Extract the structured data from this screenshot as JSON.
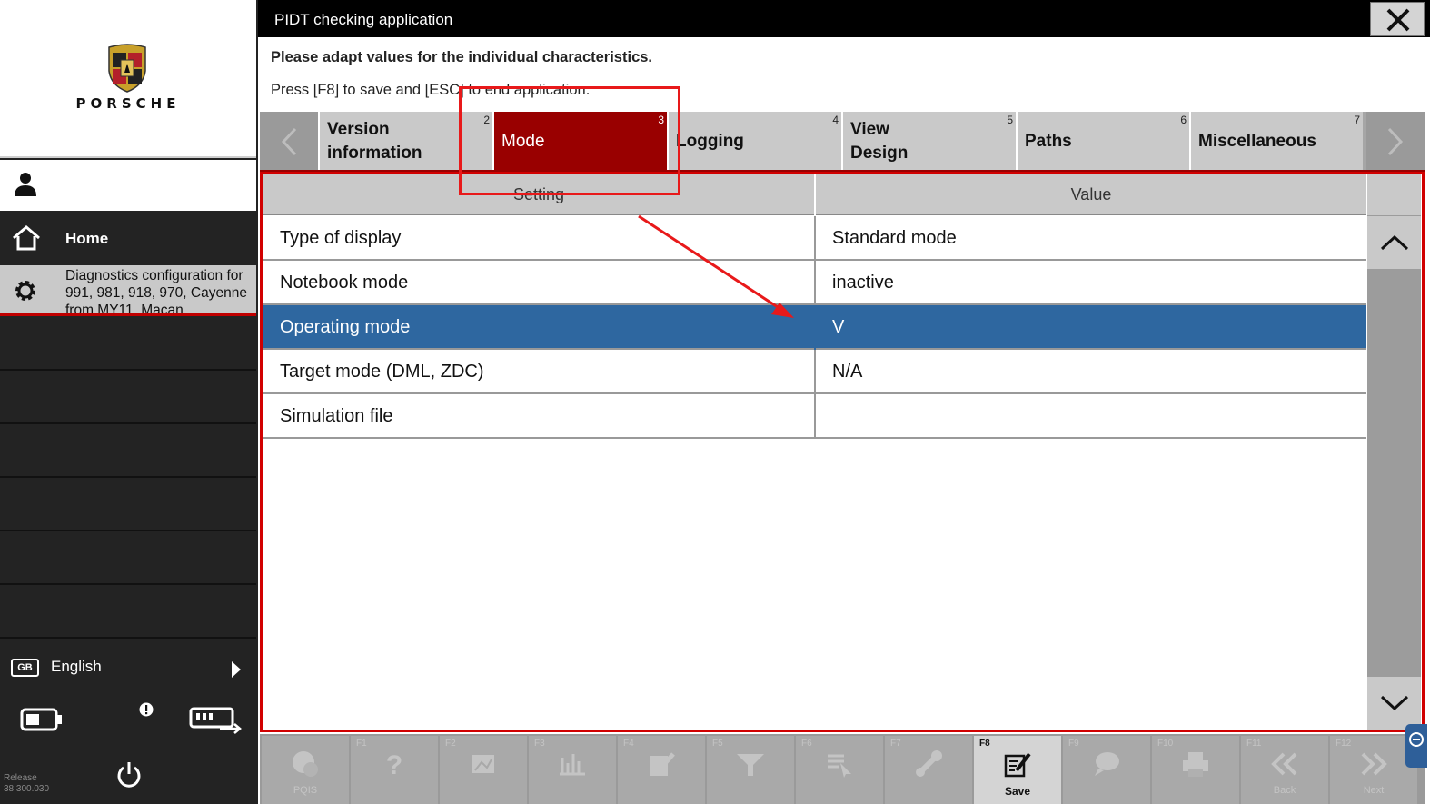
{
  "sidebar": {
    "brand": "PORSCHE",
    "home_label": "Home",
    "diag_label": "Diagnostics configuration for 991, 981, 918, 970, Cayenne from MY11, Macan",
    "language": {
      "badge": "GB",
      "label": "English"
    },
    "release_label": "Release",
    "release_version": "38.300.030"
  },
  "window": {
    "title": "PIDT checking application",
    "instruction_bold": "Please adapt values for the individual characteristics.",
    "instruction": "Press [F8] to save and [ESC] to end application."
  },
  "tabs": [
    {
      "num": "2",
      "label_line1": "Version",
      "label_line2": "information"
    },
    {
      "num": "3",
      "label_line1": "Mode",
      "label_line2": ""
    },
    {
      "num": "4",
      "label_line1": "Logging",
      "label_line2": ""
    },
    {
      "num": "5",
      "label_line1": "View",
      "label_line2": "Design"
    },
    {
      "num": "6",
      "label_line1": "Paths",
      "label_line2": ""
    },
    {
      "num": "7",
      "label_line1": "Miscellaneous",
      "label_line2": ""
    }
  ],
  "grid": {
    "headers": [
      "Setting",
      "Value"
    ],
    "rows": [
      {
        "setting": "Type of display",
        "value": "Standard mode",
        "selected": false
      },
      {
        "setting": "Notebook mode",
        "value": "inactive",
        "selected": false
      },
      {
        "setting": "Operating mode",
        "value": "V",
        "selected": true
      },
      {
        "setting": "Target mode (DML, ZDC)",
        "value": "N/A",
        "selected": false
      },
      {
        "setting": "Simulation file",
        "value": "",
        "selected": false
      }
    ]
  },
  "fkeys": [
    {
      "key": "",
      "caption": "PQIS",
      "icon": "pqis-icon"
    },
    {
      "key": "F1",
      "caption": "",
      "icon": "help-icon"
    },
    {
      "key": "F2",
      "caption": "",
      "icon": "image-icon"
    },
    {
      "key": "F3",
      "caption": "",
      "icon": "chart-icon"
    },
    {
      "key": "F4",
      "caption": "",
      "icon": "edit-list-icon"
    },
    {
      "key": "F5",
      "caption": "",
      "icon": "filter-icon"
    },
    {
      "key": "F6",
      "caption": "",
      "icon": "list-cursor-icon"
    },
    {
      "key": "F7",
      "caption": "",
      "icon": "tools-icon"
    },
    {
      "key": "F8",
      "caption": "Save",
      "icon": "save-edit-icon"
    },
    {
      "key": "F9",
      "caption": "",
      "icon": "search-bubble-icon"
    },
    {
      "key": "F10",
      "caption": "",
      "icon": "print-icon"
    },
    {
      "key": "F11",
      "caption": "Back",
      "icon": "back-icon"
    },
    {
      "key": "F12",
      "caption": "Next",
      "icon": "next-icon"
    }
  ],
  "colors": {
    "accent_red": "#990000",
    "selection_blue": "#2e67a0",
    "annotation_red": "#e8191a"
  }
}
